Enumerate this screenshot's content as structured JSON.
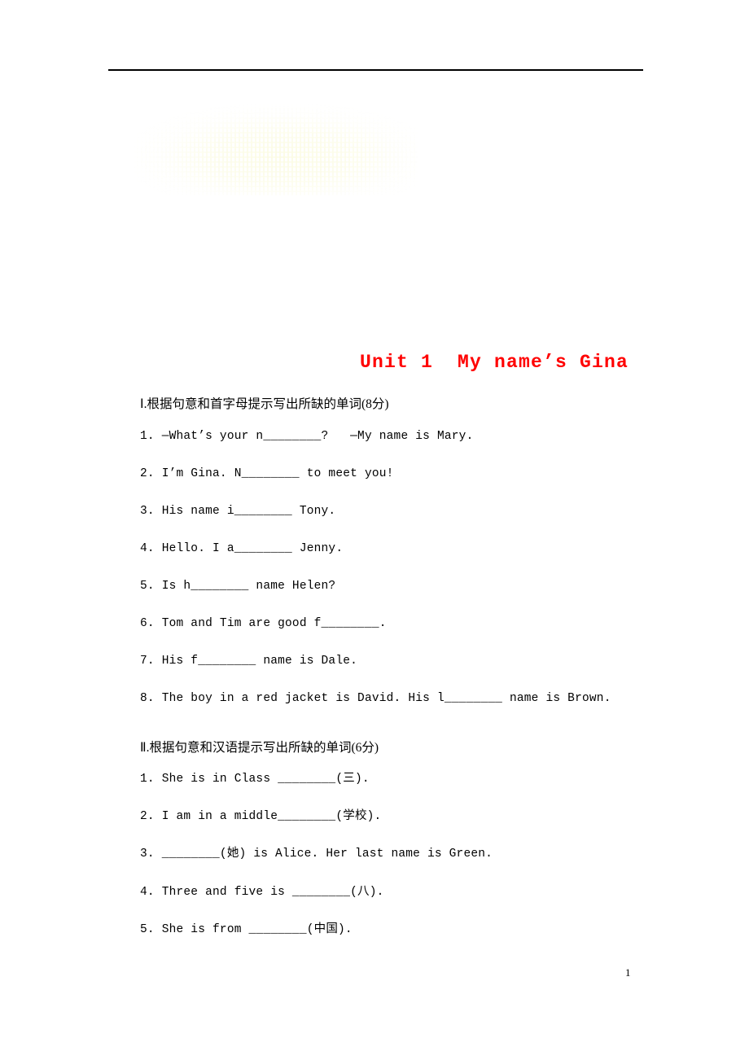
{
  "document": {
    "title": "Unit 1  My name’s Gina",
    "title_color": "#ff0000",
    "page_number": "1"
  },
  "sections": [
    {
      "heading": "Ⅰ.根据句意和首字母提示写出所缺的单词(8分)",
      "items": [
        "1. —What’s your n________?   —My name is Mary.",
        "2. I’m Gina. N________ to meet you!",
        "3. His name i________ Tony.",
        "4. Hello. I a________ Jenny.",
        "5. Is h________ name Helen?",
        "6. Tom and Tim are good f________.",
        "7. His f________ name is Dale.",
        "8. The boy in a red jacket is David. His l________ name is Brown."
      ]
    },
    {
      "heading": "Ⅱ.根据句意和汉语提示写出所缺的单词(6分)",
      "items": [
        "1. She is in Class ________(三).",
        "2. I am in a middle________(学校).",
        "3. ________(她) is Alice. Her last name is Green.",
        "4. Three and five is ________(八).",
        "5. She is from ________(中国)."
      ]
    }
  ]
}
